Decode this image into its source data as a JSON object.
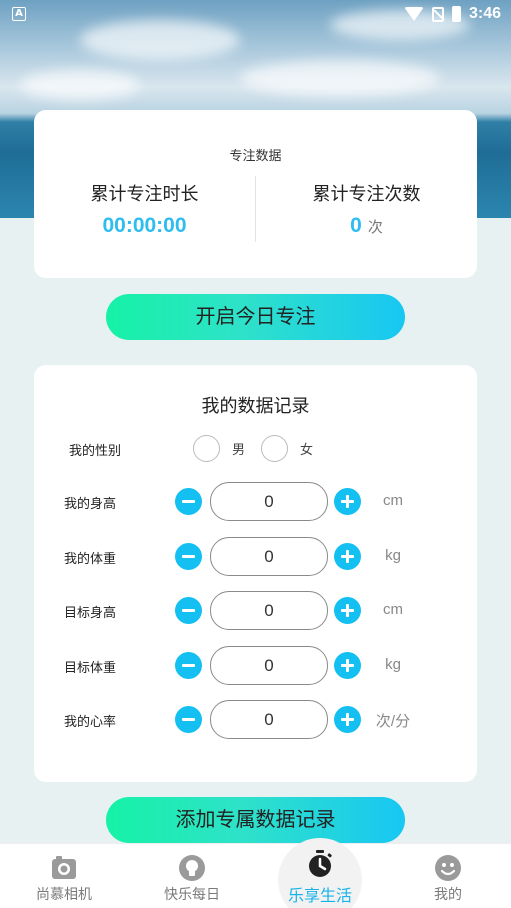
{
  "status_bar": {
    "time": "3:46",
    "left_badge": "A"
  },
  "stats": {
    "title": "专注数据",
    "total_time_label": "累计专注时长",
    "total_time_value": "00:00:00",
    "total_count_label": "累计专注次数",
    "total_count_value": "0",
    "total_count_unit": "次"
  },
  "focus_button": "开启今日专注",
  "records": {
    "title": "我的数据记录",
    "gender_label": "我的性别",
    "gender_male": "男",
    "gender_female": "女",
    "rows": [
      {
        "label": "我的身高",
        "value": "0",
        "unit": "cm"
      },
      {
        "label": "我的体重",
        "value": "0",
        "unit": "kg"
      },
      {
        "label": "目标身高",
        "value": "0",
        "unit": "cm"
      },
      {
        "label": "目标体重",
        "value": "0",
        "unit": "kg"
      },
      {
        "label": "我的心率",
        "value": "0",
        "unit": "次/分"
      }
    ]
  },
  "add_button": "添加专属数据记录",
  "nav": {
    "items": [
      {
        "label": "尚慕相机",
        "icon": "camera-icon"
      },
      {
        "label": "快乐每日",
        "icon": "lightbulb-icon"
      },
      {
        "label": "乐享生活",
        "icon": "stopwatch-icon"
      },
      {
        "label": "我的",
        "icon": "smiley-icon"
      }
    ],
    "active_index": 2
  },
  "colors": {
    "accent": "#13c0f1",
    "gradient_start": "#16f2a6",
    "gradient_end": "#18c7f2"
  }
}
